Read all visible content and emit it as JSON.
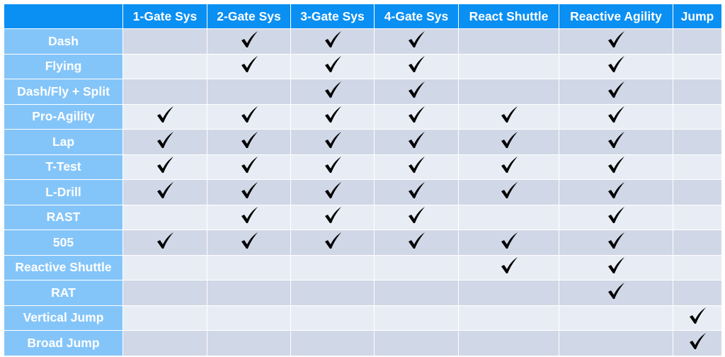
{
  "table": {
    "columns": [
      "1-Gate Sys",
      "2-Gate Sys",
      "3-Gate Sys",
      "4-Gate Sys",
      "React Shuttle",
      "Reactive Agility",
      "Jump"
    ],
    "rows": [
      {
        "label": "Dash",
        "checks": [
          false,
          true,
          true,
          true,
          false,
          true,
          false
        ]
      },
      {
        "label": "Flying",
        "checks": [
          false,
          true,
          true,
          true,
          false,
          true,
          false
        ]
      },
      {
        "label": "Dash/Fly + Split",
        "checks": [
          false,
          false,
          true,
          true,
          false,
          true,
          false
        ]
      },
      {
        "label": "Pro-Agility",
        "checks": [
          true,
          true,
          true,
          true,
          true,
          true,
          false
        ]
      },
      {
        "label": "Lap",
        "checks": [
          true,
          true,
          true,
          true,
          true,
          true,
          false
        ]
      },
      {
        "label": "T-Test",
        "checks": [
          true,
          true,
          true,
          true,
          true,
          true,
          false
        ]
      },
      {
        "label": "L-Drill",
        "checks": [
          true,
          true,
          true,
          true,
          true,
          true,
          false
        ]
      },
      {
        "label": "RAST",
        "checks": [
          false,
          true,
          true,
          true,
          false,
          true,
          false
        ]
      },
      {
        "label": "505",
        "checks": [
          true,
          true,
          true,
          true,
          true,
          true,
          false
        ]
      },
      {
        "label": "Reactive Shuttle",
        "checks": [
          false,
          false,
          false,
          false,
          true,
          true,
          false
        ]
      },
      {
        "label": "RAT",
        "checks": [
          false,
          false,
          false,
          false,
          false,
          true,
          false
        ]
      },
      {
        "label": "Vertical Jump",
        "checks": [
          false,
          false,
          false,
          false,
          false,
          false,
          true
        ]
      },
      {
        "label": "Broad Jump",
        "checks": [
          false,
          false,
          false,
          false,
          false,
          false,
          true
        ]
      }
    ],
    "check_icon": "checkmark-icon",
    "colors": {
      "header_bg": "#0a8ff2",
      "row_header_bg": "#84c5f9",
      "cell_dark": "#d0d7e6",
      "cell_light": "#e8edf5",
      "check": "#000000"
    }
  }
}
